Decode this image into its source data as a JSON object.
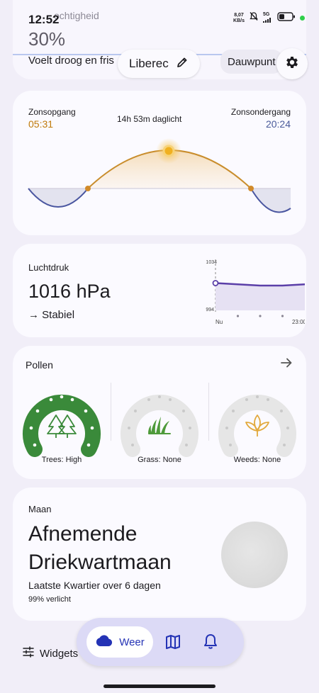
{
  "status": {
    "time": "12:52",
    "net_speed_value": "8,07",
    "net_speed_unit": "KB/s",
    "network": "5G"
  },
  "humidity": {
    "label": "ochtigheid",
    "value": "30%",
    "description": "Voelt droog en fris"
  },
  "location": {
    "name": "Liberec"
  },
  "dewpoint": {
    "label": "Dauwpunt"
  },
  "sun": {
    "sunrise_label": "Zonsopgang",
    "sunrise_time": "05:31",
    "daylight": "14h 53m daglicht",
    "sunset_label": "Zonsondergang",
    "sunset_time": "20:24",
    "colors": {
      "sunrise": "#c07a0a",
      "sunset": "#4a5a9a",
      "curve": "#c98d2c",
      "night": "#4a56a0"
    }
  },
  "pressure": {
    "title": "Luchtdruk",
    "value": "1016 hPa",
    "trend": "→ Stabiel",
    "chart": {
      "y_max_label": "1034",
      "y_min_label": "994",
      "x_start_label": "Nu",
      "x_end_label": "23:00"
    },
    "chart_data": {
      "type": "line",
      "ylim": [
        994,
        1034
      ],
      "y": [
        1016,
        1015.5,
        1015,
        1014.5,
        1014,
        1014,
        1014,
        1014.5,
        1015
      ],
      "line_color": "#5b3fa8"
    }
  },
  "pollen": {
    "title": "Pollen",
    "items": [
      {
        "label": "Trees: High",
        "level": 1.0,
        "color": "#3a8a3a",
        "icon": "tree-icon"
      },
      {
        "label": "Grass: None",
        "level": 0,
        "color": "#4e9a3a",
        "icon": "grass-icon"
      },
      {
        "label": "Weeds: None",
        "level": 0,
        "color": "#e2a93c",
        "icon": "weed-icon"
      }
    ]
  },
  "moon": {
    "title": "Maan",
    "phase_line1": "Afnemende",
    "phase_line2": "Driekwartmaan",
    "next_phase": "Laatste Kwartier over 6 dagen",
    "illumination": "99% verlicht"
  },
  "bottom": {
    "widgets_label": "Widgets",
    "nav_weather_label": "Weer"
  }
}
